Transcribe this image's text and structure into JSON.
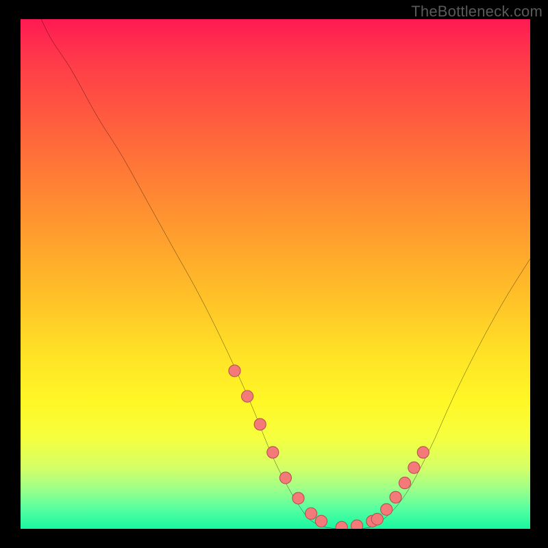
{
  "watermark": "TheBottleneck.com",
  "colors": {
    "background": "#000000",
    "curve": "#000000",
    "dot_fill": "#f47a7a",
    "dot_stroke": "#b95151"
  },
  "chart_data": {
    "type": "line",
    "title": "",
    "xlabel": "",
    "ylabel": "",
    "xlim": [
      0,
      100
    ],
    "ylim": [
      0,
      100
    ],
    "x": [
      0,
      5,
      10,
      15,
      20,
      25,
      30,
      35,
      40,
      45,
      50,
      55,
      58,
      62,
      66,
      70,
      75,
      80,
      85,
      90,
      95,
      100
    ],
    "values": [
      110,
      98,
      90,
      81,
      73,
      64,
      55,
      46,
      36,
      25,
      13,
      4,
      1,
      0,
      0,
      1,
      6,
      15,
      26,
      36,
      45,
      53
    ],
    "highlight_points": {
      "x": [
        42,
        44.5,
        47,
        49.5,
        52,
        54.5,
        57,
        59,
        63,
        66,
        69,
        70,
        71.8,
        73.6,
        75.4,
        77.2,
        79
      ],
      "y": [
        31,
        26,
        20.5,
        15,
        10,
        6,
        3,
        1.5,
        0.3,
        0.6,
        1.5,
        1.9,
        3.8,
        6.2,
        9,
        12,
        15
      ]
    }
  }
}
